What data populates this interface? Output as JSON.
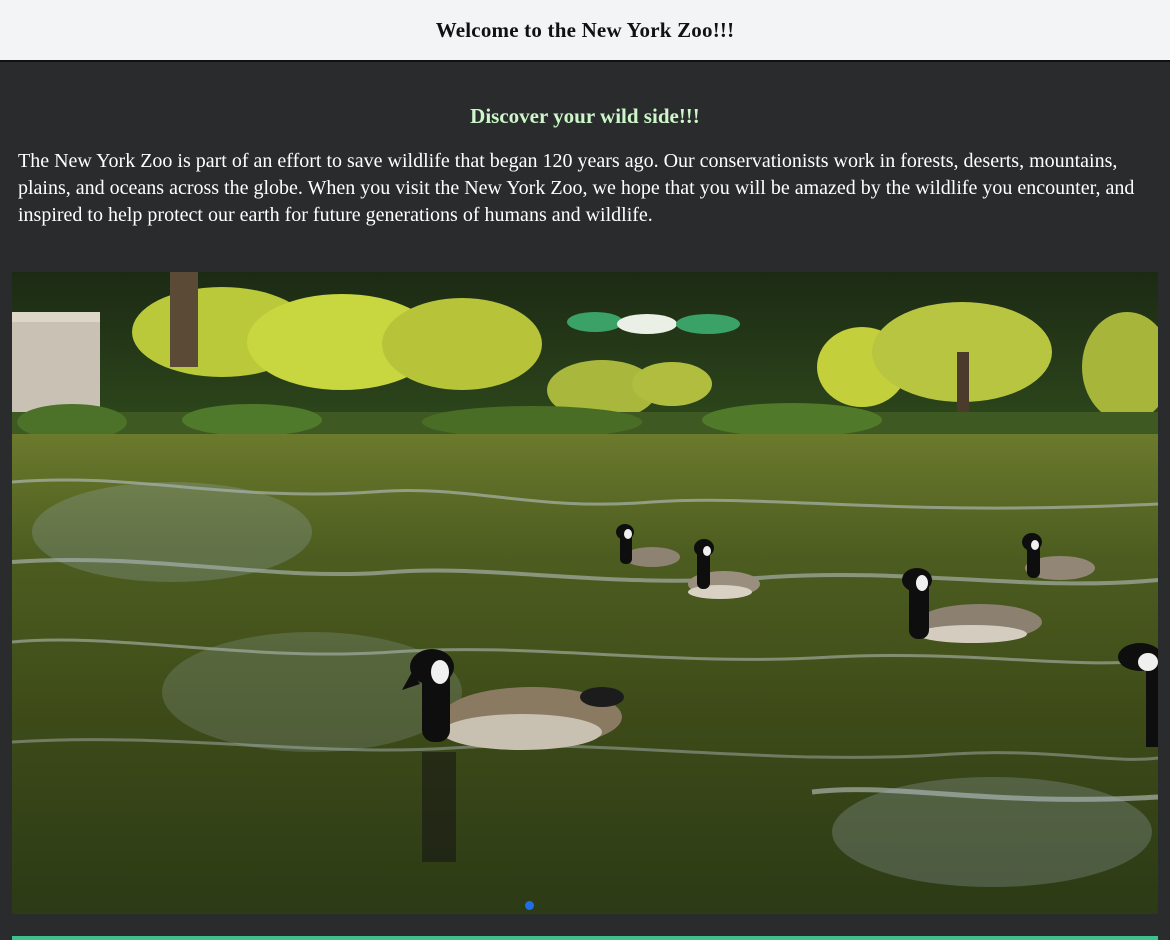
{
  "header": {
    "title": "Welcome to the New York Zoo!!!"
  },
  "main": {
    "tagline": "Discover your wild side!!!",
    "intro": "The New York Zoo is part of an effort to save wildlife that began 120 years ago. Our conservationists work in forests, deserts, mountains, plains, and oceans across the globe. When you visit the New York Zoo, we hope that you will be amazed by the wildlife you encounter, and inspired to help protect our earth for future generations of humans and wildlife."
  },
  "carousel": {
    "slide_count": 1,
    "active_slide": 1
  },
  "colors": {
    "header_bg": "#f3f4f6",
    "page_bg": "#2a2b2d",
    "tagline": "#cdf7c9",
    "dot_active": "#1e6fe6",
    "accent_strip": "#3ec28d"
  }
}
